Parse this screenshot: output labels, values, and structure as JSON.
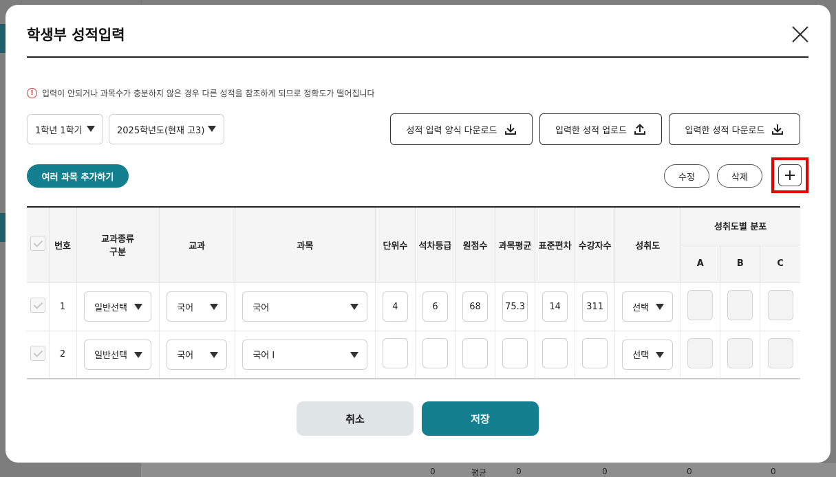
{
  "background": {
    "footer_avg_label": "평균",
    "footer_zeros": [
      "0",
      "0",
      "0",
      "0",
      "0"
    ]
  },
  "modal": {
    "title": "학생부 성적입력",
    "notice": "입력이 안되거나 과목수가 충분하지 않은 경우 다른 성적을 참조하게 되므로 정확도가 떨어집니다",
    "notice_icon": "!",
    "semester_select": "1학년 1학기",
    "year_select": "2025학년도(현재 고3)",
    "download_template_label": "성적 입력 양식 다운로드",
    "upload_label": "입력한 성적 업로드",
    "download_scores_label": "입력한 성적 다운로드",
    "add_multi_label": "여러 과목 추가하기",
    "edit_label": "수정",
    "delete_label": "삭제",
    "plus_label": "+",
    "cancel_label": "취소",
    "save_label": "저장"
  },
  "table": {
    "headers": {
      "no": "번호",
      "type_line1": "교과종류",
      "type_line2": "구분",
      "subject_group": "교과",
      "subject": "과목",
      "units": "단위수",
      "rank_grade": "석차등급",
      "raw_score": "원점수",
      "subject_avg": "과목평균",
      "std_dev": "표준편차",
      "students": "수강자수",
      "achievement": "성취도",
      "distribution": "성취도별 분포",
      "dist_a": "A",
      "dist_b": "B",
      "dist_c": "C"
    },
    "rows": [
      {
        "no": "1",
        "type": "일반선택",
        "subject_group": "국어",
        "subject": "국어",
        "units": "4",
        "rank_grade": "6",
        "raw_score": "68",
        "subject_avg": "75.3",
        "std_dev": "14",
        "students": "311",
        "achievement": "선택"
      },
      {
        "no": "2",
        "type": "일반선택",
        "subject_group": "국어",
        "subject": "국어 I",
        "units": "",
        "rank_grade": "",
        "raw_score": "",
        "subject_avg": "",
        "std_dev": "",
        "students": "",
        "achievement": "선택"
      }
    ]
  },
  "colors": {
    "accent": "#14808f",
    "highlight": "#e60000",
    "warning": "#d63b3b"
  }
}
